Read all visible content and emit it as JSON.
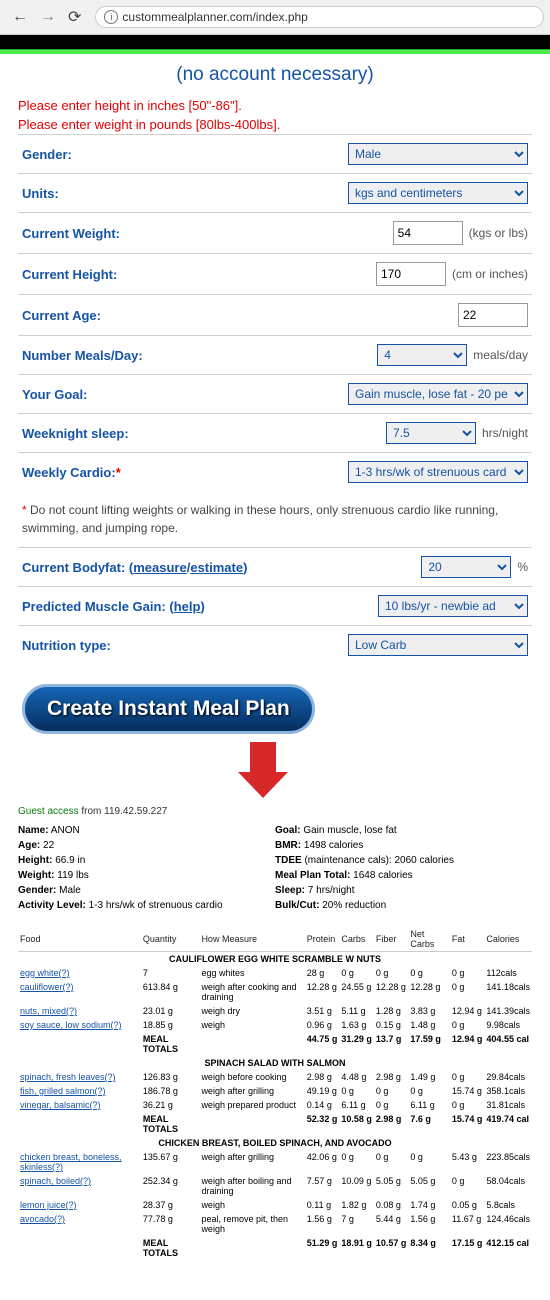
{
  "browser": {
    "url": "custommealplanner.com/index.php"
  },
  "subtitle": "(no account necessary)",
  "errors": [
    "Please enter height in inches [50\"-86\"].",
    "Please enter weight in pounds [80lbs-400lbs]."
  ],
  "form": {
    "gender": {
      "label": "Gender:",
      "value": "Male"
    },
    "units": {
      "label": "Units:",
      "value": "kgs and centimeters"
    },
    "weight": {
      "label": "Current Weight:",
      "value": "54",
      "suffix": "(kgs or lbs)"
    },
    "height": {
      "label": "Current Height:",
      "value": "170",
      "suffix": "(cm or inches)"
    },
    "age": {
      "label": "Current Age:",
      "value": "22"
    },
    "meals": {
      "label": "Number Meals/Day:",
      "value": "4",
      "suffix": "meals/day"
    },
    "goal": {
      "label": "Your Goal:",
      "value": "Gain muscle, lose fat - 20 pe"
    },
    "sleep": {
      "label": "Weeknight sleep:",
      "value": "7.5",
      "suffix": "hrs/night"
    },
    "cardio": {
      "label": "Weekly Cardio:",
      "star": "*",
      "value": "1-3 hrs/wk of strenuous card"
    },
    "note": "Do not count lifting weights or walking in these hours, only strenuous cardio like running, swimming, and jumping rope.",
    "bf": {
      "label": "Current Bodyfat:",
      "link1": "measure",
      "link2": "estimate",
      "value": "20",
      "suffix": "%"
    },
    "gain": {
      "label": "Predicted Muscle Gain:",
      "help": "help",
      "value": "10 lbs/yr - newbie ad"
    },
    "ntype": {
      "label": "Nutrition type:",
      "value": "Low Carb"
    }
  },
  "button": "Create Instant Meal Plan",
  "guest": {
    "pre": "Guest access",
    "post": " from 119.42.59.227"
  },
  "colA": [
    {
      "l": "Name:",
      "v": " ANON"
    },
    {
      "l": "Age:",
      "v": " 22"
    },
    {
      "l": "Height:",
      "v": " 66.9 in"
    },
    {
      "l": "Weight:",
      "v": " 119 lbs"
    },
    {
      "l": "Gender:",
      "v": " Male"
    },
    {
      "l": "Activity Level:",
      "v": " 1-3 hrs/wk of strenuous cardio"
    }
  ],
  "colB": [
    {
      "l": "Goal:",
      "v": " Gain muscle, lose fat"
    },
    {
      "l": "BMR:",
      "v": " 1498 calories"
    },
    {
      "l": "TDEE",
      "v": " (maintenance cals): 2060 calories"
    },
    {
      "l": "Meal Plan Total:",
      "v": " 1648 calories"
    },
    {
      "l": "Sleep:",
      "v": " 7 hrs/night"
    },
    {
      "l": "Bulk/Cut:",
      "v": " 20% reduction"
    }
  ],
  "headers": [
    "Food",
    "Quantity",
    "How Measure",
    "Protein",
    "Carbs",
    "Fiber",
    "Net Carbs",
    "Fat",
    "Calories"
  ],
  "sections": [
    {
      "title": "CAULIFLOWER EGG WHITE SCRAMBLE W NUTS",
      "rows": [
        {
          "f": "egg white(?)",
          "q": "7",
          "m": "egg whites",
          "p": "28 g",
          "c": "0 g",
          "fi": "0 g",
          "nc": "0 g",
          "fa": "0 g",
          "cal": "112cals"
        },
        {
          "f": "cauliflower(?)",
          "q": "613.84 g",
          "m": "weigh after cooking and draining",
          "p": "12.28 g",
          "c": "24.55 g",
          "fi": "12.28 g",
          "nc": "12.28 g",
          "fa": "0 g",
          "cal": "141.18cals"
        },
        {
          "f": "nuts, mixed(?)",
          "q": "23.01 g",
          "m": "weigh dry",
          "p": "3.51 g",
          "c": "5.11 g",
          "fi": "1.28 g",
          "nc": "3.83 g",
          "fa": "12.94 g",
          "cal": "141.39cals"
        },
        {
          "f": "soy sauce, low sodium(?)",
          "q": "18.85 g",
          "m": "weigh",
          "p": "0.96 g",
          "c": "1.63 g",
          "fi": "0.15 g",
          "nc": "1.48 g",
          "fa": "0 g",
          "cal": "9.98cals"
        }
      ],
      "tot": {
        "q": "MEAL TOTALS",
        "p": "44.75 g",
        "c": "31.29 g",
        "fi": "13.7 g",
        "nc": "17.59 g",
        "fa": "12.94 g",
        "cal": "404.55 cal"
      }
    },
    {
      "title": "SPINACH SALAD WITH SALMON",
      "rows": [
        {
          "f": "spinach, fresh leaves(?)",
          "q": "126.83 g",
          "m": "weigh before cooking",
          "p": "2.98 g",
          "c": "4.48 g",
          "fi": "2.98 g",
          "nc": "1.49 g",
          "fa": "0 g",
          "cal": "29.84cals"
        },
        {
          "f": "fish, grilled salmon(?)",
          "q": "186.78 g",
          "m": "weigh after grilling",
          "p": "49.19 g",
          "c": "0 g",
          "fi": "0 g",
          "nc": "0 g",
          "fa": "15.74 g",
          "cal": "358.1cals"
        },
        {
          "f": "vinegar, balsamic(?)",
          "q": "36.21 g",
          "m": "weigh prepared product",
          "p": "0.14 g",
          "c": "6.11 g",
          "fi": "0 g",
          "nc": "6.11 g",
          "fa": "0 g",
          "cal": "31.81cals"
        }
      ],
      "tot": {
        "q": "MEAL TOTALS",
        "p": "52.32 g",
        "c": "10.58 g",
        "fi": "2.98 g",
        "nc": "7.6 g",
        "fa": "15.74 g",
        "cal": "419.74 cal"
      }
    },
    {
      "title": "CHICKEN BREAST, BOILED SPINACH, AND AVOCADO",
      "rows": [
        {
          "f": "chicken breast, boneless, skinless(?)",
          "q": "135.67 g",
          "m": "weigh after grilling",
          "p": "42.06 g",
          "c": "0 g",
          "fi": "0 g",
          "nc": "0 g",
          "fa": "5.43 g",
          "cal": "223.85cals"
        },
        {
          "f": "spinach, boiled(?)",
          "q": "252.34 g",
          "m": "weigh after boiling and draining",
          "p": "7.57 g",
          "c": "10.09 g",
          "fi": "5.05 g",
          "nc": "5.05 g",
          "fa": "0 g",
          "cal": "58.04cals"
        },
        {
          "f": "lemon juice(?)",
          "q": "28.37 g",
          "m": "weigh",
          "p": "0.11 g",
          "c": "1.82 g",
          "fi": "0.08 g",
          "nc": "1.74 g",
          "fa": "0.05 g",
          "cal": "5.8cals"
        },
        {
          "f": "avocado(?)",
          "q": "77.78 g",
          "m": "peal, remove pit, then weigh",
          "p": "1.56 g",
          "c": "7 g",
          "fi": "5.44 g",
          "nc": "1.56 g",
          "fa": "11.67 g",
          "cal": "124.46cals"
        }
      ],
      "tot": {
        "q": "MEAL TOTALS",
        "p": "51.29 g",
        "c": "18.91 g",
        "fi": "10.57 g",
        "nc": "8.34 g",
        "fa": "17.15 g",
        "cal": "412.15 cal"
      }
    }
  ]
}
